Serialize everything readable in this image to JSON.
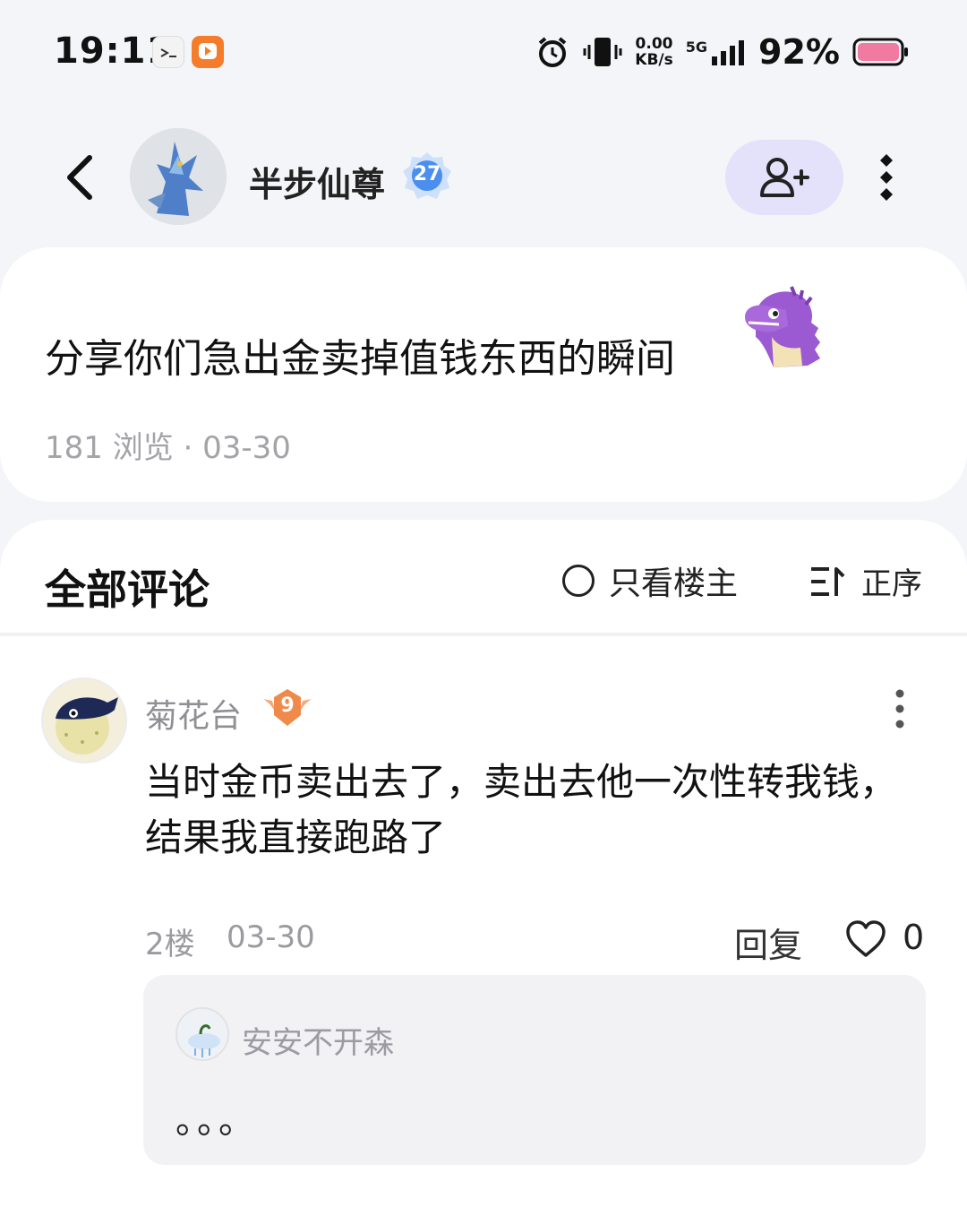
{
  "status_bar": {
    "time": "19:11",
    "net_speed_value": "0.00",
    "net_speed_unit": "KB/s",
    "network_type": "5G",
    "battery_percent": "92%"
  },
  "header": {
    "author_name": "半步仙尊",
    "author_level": "27"
  },
  "post": {
    "title": "分享你们急出金卖掉值钱东西的瞬间",
    "views": "181 浏览",
    "date": "03-30"
  },
  "comments": {
    "heading": "全部评论",
    "only_op_label": "只看楼主",
    "sort_label": "正序",
    "items": [
      {
        "username": "菊花台",
        "level": "9",
        "text": "当时金币卖出去了，卖出去他一次性转我钱，结果我直接跑路了",
        "floor": "2楼",
        "date": "03-30",
        "reply_label": "回复",
        "likes": "0",
        "replies": [
          {
            "username": "安安不开森",
            "text": "。。。"
          }
        ]
      }
    ]
  },
  "colors": {
    "follow_button_bg": "#e4e1fb",
    "level_badge_blue": "#4a8ff0",
    "level_badge_orange": "#f08a4b",
    "battery_fill": "#f07aa0"
  },
  "icons": [
    "back-arrow-icon",
    "follow-user-icon",
    "more-vertical-icon",
    "heart-icon",
    "sort-icon",
    "alarm-icon",
    "vibrate-icon",
    "signal-icon",
    "battery-icon"
  ]
}
